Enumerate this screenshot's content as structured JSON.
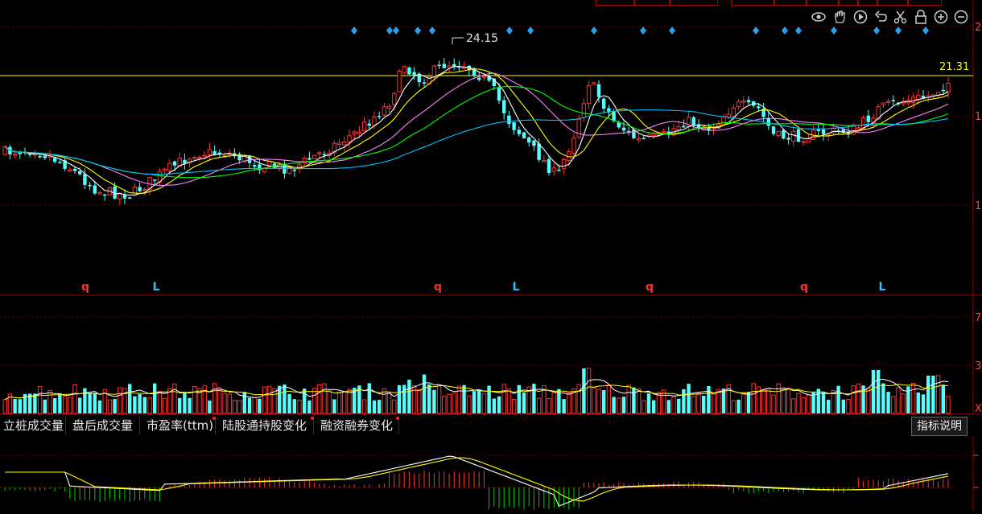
{
  "top_tabs": [
    "",
    "",
    "",
    "",
    "",
    "",
    "",
    "",
    "",
    ""
  ],
  "price_panel": {
    "peak_label": "24.15",
    "last_price_label": "21.31",
    "axis_labels": [
      "2",
      "1",
      "1"
    ],
    "signal_letters": [
      {
        "letter": "q",
        "color": "#ff3030"
      },
      {
        "letter": "L",
        "color": "#30c0ff"
      },
      {
        "letter": "q",
        "color": "#ff3030"
      },
      {
        "letter": "L",
        "color": "#30c0ff"
      },
      {
        "letter": "q",
        "color": "#ff3030"
      },
      {
        "letter": "q",
        "color": "#ff3030"
      },
      {
        "letter": "L",
        "color": "#30c0ff"
      }
    ]
  },
  "volume_panel": {
    "axis_labels": [
      "7",
      "3",
      "X"
    ]
  },
  "tabs": [
    {
      "label": "立桩成交量",
      "dot": false
    },
    {
      "label": "盘后成交量",
      "dot": false
    },
    {
      "label": "市盈率(ttm)",
      "dot": true
    },
    {
      "label": "陆股通持股变化",
      "dot": true
    },
    {
      "label": "融资融券变化",
      "dot": true
    }
  ],
  "indicator_help_label": "指标说明",
  "toolbar_icons": [
    "eye-icon",
    "hand-icon",
    "play-icon",
    "undo-icon",
    "scissors-icon",
    "lock-icon",
    "zoom-in-icon",
    "zoom-out-icon"
  ],
  "colors": {
    "up": "#ff3232",
    "down": "#54ffff",
    "grid": "#8b0000",
    "ma5": "#ffffff",
    "ma10": "#ffff00",
    "ma20": "#ff80ff",
    "ma30": "#00ff00",
    "ma60": "#00c0ff",
    "last_price_line": "#ffff00"
  }
}
